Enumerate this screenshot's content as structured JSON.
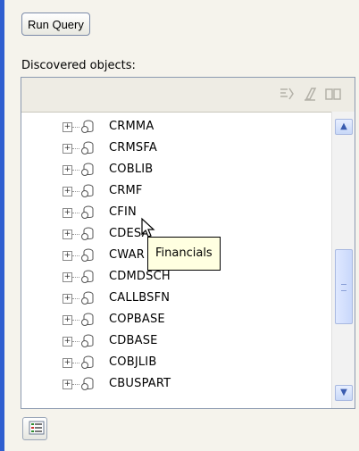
{
  "toolbar": {
    "run_query_label": "Run Query"
  },
  "discovered": {
    "label": "Discovered objects:",
    "toolbar_icons": [
      "pin-filter-icon",
      "eraser-icon",
      "book-icon"
    ],
    "items": [
      {
        "name": "CRMMA"
      },
      {
        "name": "CRMSFA"
      },
      {
        "name": "COBLIB"
      },
      {
        "name": "CRMF"
      },
      {
        "name": "CFIN"
      },
      {
        "name": "CDESA"
      },
      {
        "name": "CWAR"
      },
      {
        "name": "CDMDSCH"
      },
      {
        "name": "CALLBSFN"
      },
      {
        "name": "COPBASE"
      },
      {
        "name": "CDBASE"
      },
      {
        "name": "COBJLIB"
      },
      {
        "name": "CBUSPART"
      }
    ]
  },
  "tooltip": {
    "text": "Financials"
  },
  "bottom_toolbar": {
    "icon": "list-view-icon"
  }
}
